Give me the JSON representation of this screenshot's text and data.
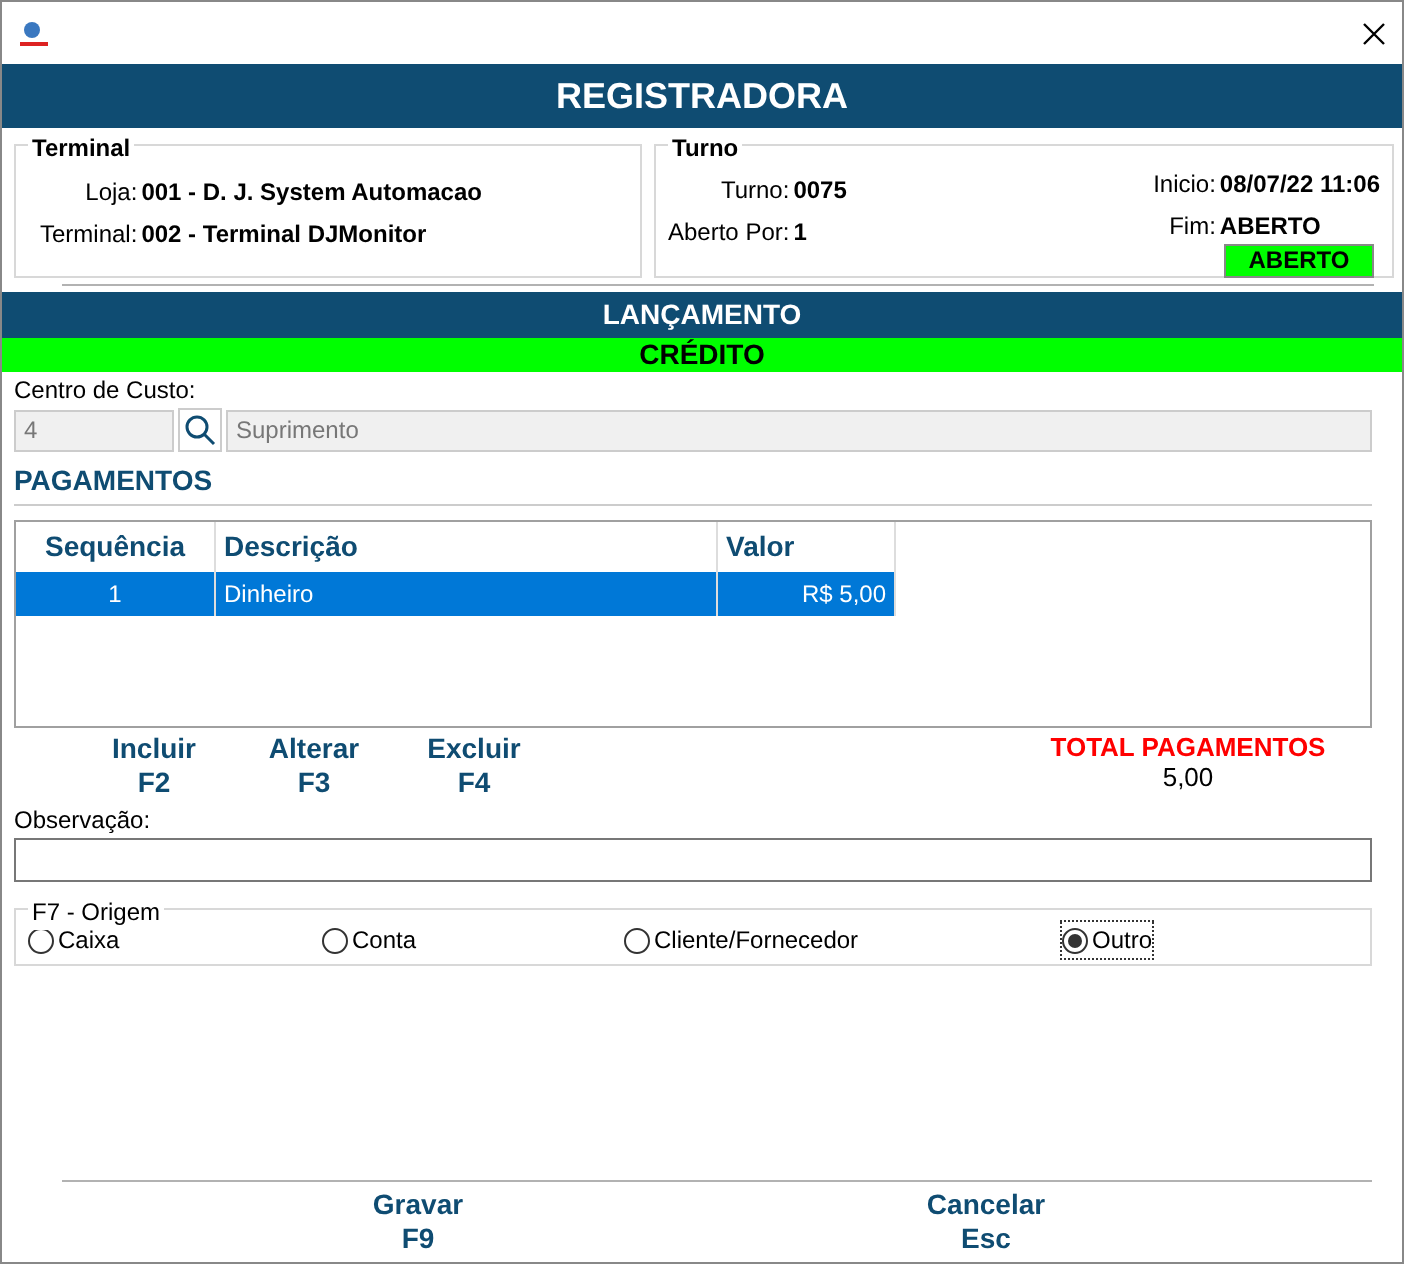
{
  "header": "REGISTRADORA",
  "terminal": {
    "title": "Terminal",
    "fields": [
      {
        "label": "Loja:",
        "value": "001 - D. J. System Automacao"
      },
      {
        "label": "Terminal:",
        "value": "002 - Terminal DJMonitor"
      }
    ]
  },
  "turno": {
    "title": "Turno",
    "left": [
      {
        "label": "Turno:",
        "value": "0075"
      },
      {
        "label": "Aberto Por:",
        "value": "1"
      }
    ],
    "right": [
      {
        "label": "Inicio:",
        "value": "08/07/22 11:06"
      },
      {
        "label": "Fim:",
        "value": "ABERTO"
      }
    ],
    "status": "ABERTO"
  },
  "section": "LANÇAMENTO",
  "type_banner": "CRÉDITO",
  "cost_center": {
    "label": "Centro de Custo:",
    "code": "4",
    "description": "Suprimento",
    "disabled": true
  },
  "payments": {
    "title": "PAGAMENTOS",
    "columns": [
      "Sequência",
      "Descrição",
      "Valor"
    ],
    "rows": [
      {
        "cells": [
          "1",
          "Dinheiro",
          "R$ 5,00"
        ],
        "selected": true
      }
    ]
  },
  "actions": [
    {
      "label": "Incluir",
      "key": "F2"
    },
    {
      "label": "Alterar",
      "key": "F3"
    },
    {
      "label": "Excluir",
      "key": "F4"
    }
  ],
  "total": {
    "label": "TOTAL PAGAMENTOS",
    "value": "5,00"
  },
  "observation": {
    "label": "Observação:"
  },
  "origin": {
    "title": "F7 - Origem",
    "options": [
      {
        "label": "Caixa",
        "selected": false
      },
      {
        "label": "Conta",
        "selected": false
      },
      {
        "label": "Cliente/Fornecedor",
        "selected": false
      },
      {
        "label": "Outro",
        "selected": true
      }
    ]
  },
  "footer_buttons": [
    {
      "label": "Gravar",
      "key": "F9"
    },
    {
      "label": "Cancelar",
      "key": "Esc"
    }
  ]
}
